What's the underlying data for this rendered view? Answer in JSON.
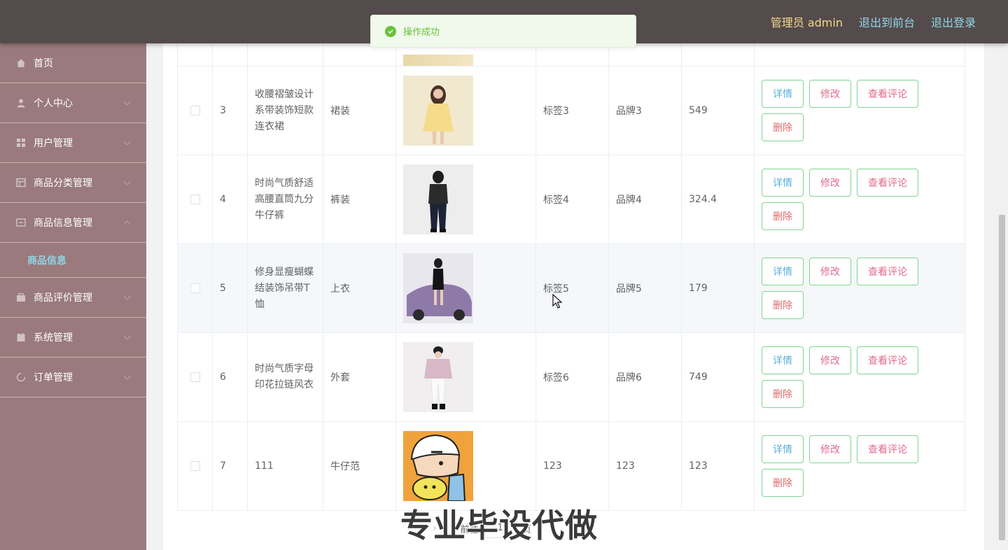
{
  "header": {
    "user": "管理员 admin",
    "links": [
      "退出到前台",
      "退出登录"
    ]
  },
  "toast": {
    "message": "操作成功",
    "color": "#67c23a"
  },
  "sidebar": {
    "items": [
      {
        "label": "首页",
        "icon": "home-icon"
      },
      {
        "label": "个人中心",
        "icon": "user-icon"
      },
      {
        "label": "用户管理",
        "icon": "grid-icon"
      },
      {
        "label": "商品分类管理",
        "icon": "table-icon"
      },
      {
        "label": "商品信息管理",
        "icon": "list-icon"
      },
      {
        "label": "商品评价管理",
        "icon": "box-icon"
      },
      {
        "label": "系统管理",
        "icon": "calendar-icon"
      },
      {
        "label": "订单管理",
        "icon": "loading-icon"
      }
    ],
    "sub_item": "商品信息"
  },
  "table": {
    "rows": [
      {
        "id": "3",
        "name": "收腰褶皱设计系带装饰短款连衣裙",
        "category": "裙装",
        "tag": "标签3",
        "brand": "品牌3",
        "price": "549"
      },
      {
        "id": "4",
        "name": "时尚气质舒适高腰直筒九分牛仔裤",
        "category": "裤装",
        "tag": "标签4",
        "brand": "品牌4",
        "price": "324.4"
      },
      {
        "id": "5",
        "name": "修身显瘦蝴蝶结装饰吊带T恤",
        "category": "上衣",
        "tag": "标签5",
        "brand": "品牌5",
        "price": "179"
      },
      {
        "id": "6",
        "name": "时尚气质字母印花拉链风衣",
        "category": "外套",
        "tag": "标签6",
        "brand": "品牌6",
        "price": "749"
      },
      {
        "id": "7",
        "name": "111",
        "category": "牛仔范",
        "tag": "123",
        "brand": "123",
        "price": "123"
      }
    ],
    "actions": {
      "detail": "详情",
      "edit": "修改",
      "review": "查看评论",
      "delete": "删除"
    }
  },
  "pagination": {
    "goto_prefix": "前往",
    "page": "1",
    "goto_suffix": "页"
  },
  "watermark": "专业毕设代做",
  "colors": {
    "topbar": "#544b4c",
    "sidebar": "#9a7a7c",
    "accent": "#8fd6e6",
    "button_border": "#7fd692"
  }
}
